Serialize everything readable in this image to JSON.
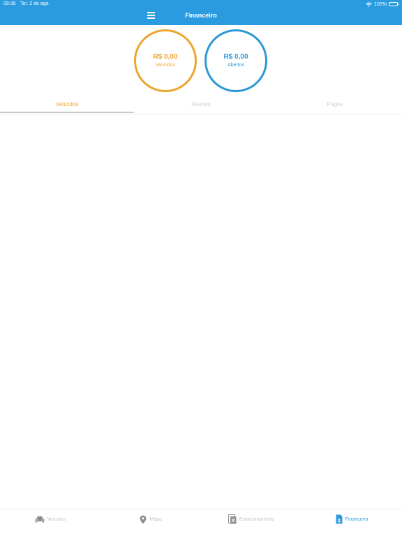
{
  "status_bar": {
    "time": "09:39",
    "date": "Ter. 2 de ago.",
    "battery": "100%",
    "wifi_icon": "wifi-icon",
    "battery_icon": "battery-icon"
  },
  "header": {
    "menu_icon": "hamburger-menu-icon",
    "title": "Financeiro",
    "background_color": "#2b9be0"
  },
  "summary": {
    "overdue": {
      "amount": "R$ 0,00",
      "label": "Vencidos",
      "color": "#eba530"
    },
    "open": {
      "amount": "R$ 0,00",
      "label": "Abertos",
      "color": "#2d99d4"
    }
  },
  "tabs": [
    {
      "label": "Vencidos",
      "active": true
    },
    {
      "label": "Abertos",
      "active": false
    },
    {
      "label": "Pagos",
      "active": false
    }
  ],
  "bottom_tabs": [
    {
      "label": "Veículos",
      "icon": "car-icon",
      "active": false
    },
    {
      "label": "Mapa",
      "icon": "map-pin-icon",
      "active": false
    },
    {
      "label": "Estacionamento",
      "icon": "parking-ticket-icon",
      "active": false
    },
    {
      "label": "Financeiro",
      "icon": "invoice-icon",
      "active": true
    }
  ]
}
